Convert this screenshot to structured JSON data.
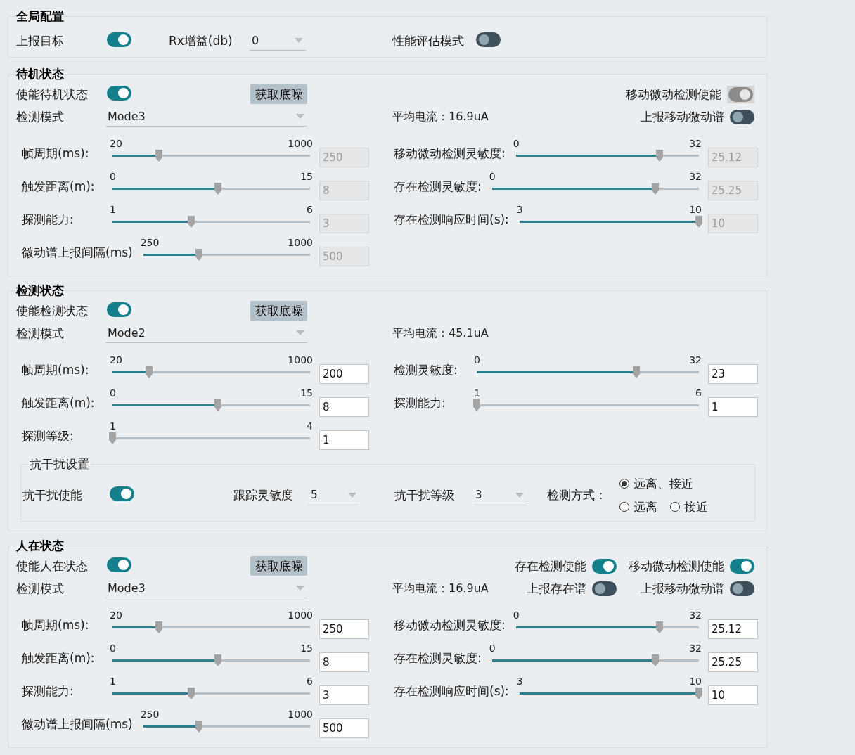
{
  "global": {
    "title": "全局配置",
    "report_target": {
      "label": "上报目标",
      "on": true
    },
    "rx_gain": {
      "label": "Rx增益(db)",
      "value": "0"
    },
    "perf_eval": {
      "label": "性能评估模式",
      "on": false
    }
  },
  "sections": [
    {
      "title": "待机状态",
      "enable": {
        "label": "使能待机状态",
        "on": true
      },
      "noise_button": "获取底噪",
      "top_toggles": [
        {
          "label": "移动微动检测使能",
          "on": true,
          "disabled": true
        }
      ],
      "mode": {
        "label": "检测模式",
        "value": "Mode3"
      },
      "current": "平均电流：16.9uA",
      "mode_toggles": [
        {
          "label": "上报移动微动谱",
          "on": false,
          "disabled": false
        }
      ],
      "left_sliders": [
        {
          "label": "帧周期(ms):",
          "min": "20",
          "max": "1000",
          "level": 0.235,
          "value": "250",
          "disabled": true
        },
        {
          "label": "触发距离(m):",
          "min": "0",
          "max": "15",
          "level": 0.533,
          "value": "8",
          "disabled": true
        },
        {
          "label": "探测能力:",
          "min": "1",
          "max": "6",
          "level": 0.4,
          "value": "3",
          "disabled": true
        },
        {
          "label": "微动谱上报间隔(ms)",
          "min": "250",
          "max": "1000",
          "level": 0.333,
          "value": "500",
          "disabled": true
        }
      ],
      "right_sliders": [
        {
          "label": "移动微动检测灵敏度:",
          "min": "0",
          "max": "32",
          "level": 0.785,
          "value": "25.12",
          "disabled": true
        },
        {
          "label": "存在检测灵敏度:",
          "min": "0",
          "max": "32",
          "level": 0.789,
          "value": "25.25",
          "disabled": true
        },
        {
          "label": "存在检测响应时间(s):",
          "min": "3",
          "max": "10",
          "level": 1,
          "value": "10",
          "disabled": true
        }
      ]
    },
    {
      "title": "检测状态",
      "enable": {
        "label": "使能检测状态",
        "on": true
      },
      "noise_button": "获取底噪",
      "mode": {
        "label": "检测模式",
        "value": "Mode2"
      },
      "current": "平均电流：45.1uA",
      "left_sliders": [
        {
          "label": "帧周期(ms):",
          "min": "20",
          "max": "1000",
          "level": 0.184,
          "value": "200",
          "disabled": false
        },
        {
          "label": "触发距离(m):",
          "min": "0",
          "max": "15",
          "level": 0.533,
          "value": "8",
          "disabled": false
        },
        {
          "label": "探测等级:",
          "min": "1",
          "max": "4",
          "level": 0,
          "value": "1",
          "disabled": false
        }
      ],
      "right_sliders": [
        {
          "label": "检测灵敏度:",
          "min": "0",
          "max": "32",
          "level": 0.719,
          "value": "23",
          "disabled": false
        },
        {
          "label": "探测能力:",
          "min": "1",
          "max": "6",
          "level": 0,
          "value": "1",
          "disabled": false
        }
      ],
      "anti_interference": {
        "title": "抗干扰设置",
        "enable": {
          "label": "抗干扰使能",
          "on": true
        },
        "tracking": {
          "label": "跟踪灵敏度",
          "value": "5"
        },
        "interference_level": {
          "label": "抗干扰等级",
          "value": "3"
        },
        "method": {
          "label": "检测方式：",
          "options": [
            {
              "label": "远离、接近",
              "selected": true
            },
            {
              "label": "远离",
              "selected": false
            },
            {
              "label": "接近",
              "selected": false
            }
          ]
        }
      }
    },
    {
      "title": "人在状态",
      "enable": {
        "label": "使能人在状态",
        "on": true
      },
      "noise_button": "获取底噪",
      "top_toggles": [
        {
          "label": "存在检测使能",
          "on": true,
          "disabled": false
        },
        {
          "label": "移动微动检测使能",
          "on": true,
          "disabled": false
        }
      ],
      "mode": {
        "label": "检测模式",
        "value": "Mode3"
      },
      "current": "平均电流：16.9uA",
      "mode_toggles": [
        {
          "label": "上报存在谱",
          "on": false,
          "disabled": false
        },
        {
          "label": "上报移动微动谱",
          "on": false,
          "disabled": false
        }
      ],
      "left_sliders": [
        {
          "label": "帧周期(ms):",
          "min": "20",
          "max": "1000",
          "level": 0.235,
          "value": "250",
          "disabled": false
        },
        {
          "label": "触发距离(m):",
          "min": "0",
          "max": "15",
          "level": 0.533,
          "value": "8",
          "disabled": false
        },
        {
          "label": "探测能力:",
          "min": "1",
          "max": "6",
          "level": 0.4,
          "value": "3",
          "disabled": false
        },
        {
          "label": "微动谱上报间隔(ms)",
          "min": "250",
          "max": "1000",
          "level": 0.333,
          "value": "500",
          "disabled": false
        }
      ],
      "right_sliders": [
        {
          "label": "移动微动检测灵敏度:",
          "min": "0",
          "max": "32",
          "level": 0.785,
          "value": "25.12",
          "disabled": false
        },
        {
          "label": "存在检测灵敏度:",
          "min": "0",
          "max": "32",
          "level": 0.789,
          "value": "25.25",
          "disabled": false
        },
        {
          "label": "存在检测响应时间(s):",
          "min": "3",
          "max": "10",
          "level": 1,
          "value": "10",
          "disabled": false
        }
      ]
    }
  ]
}
